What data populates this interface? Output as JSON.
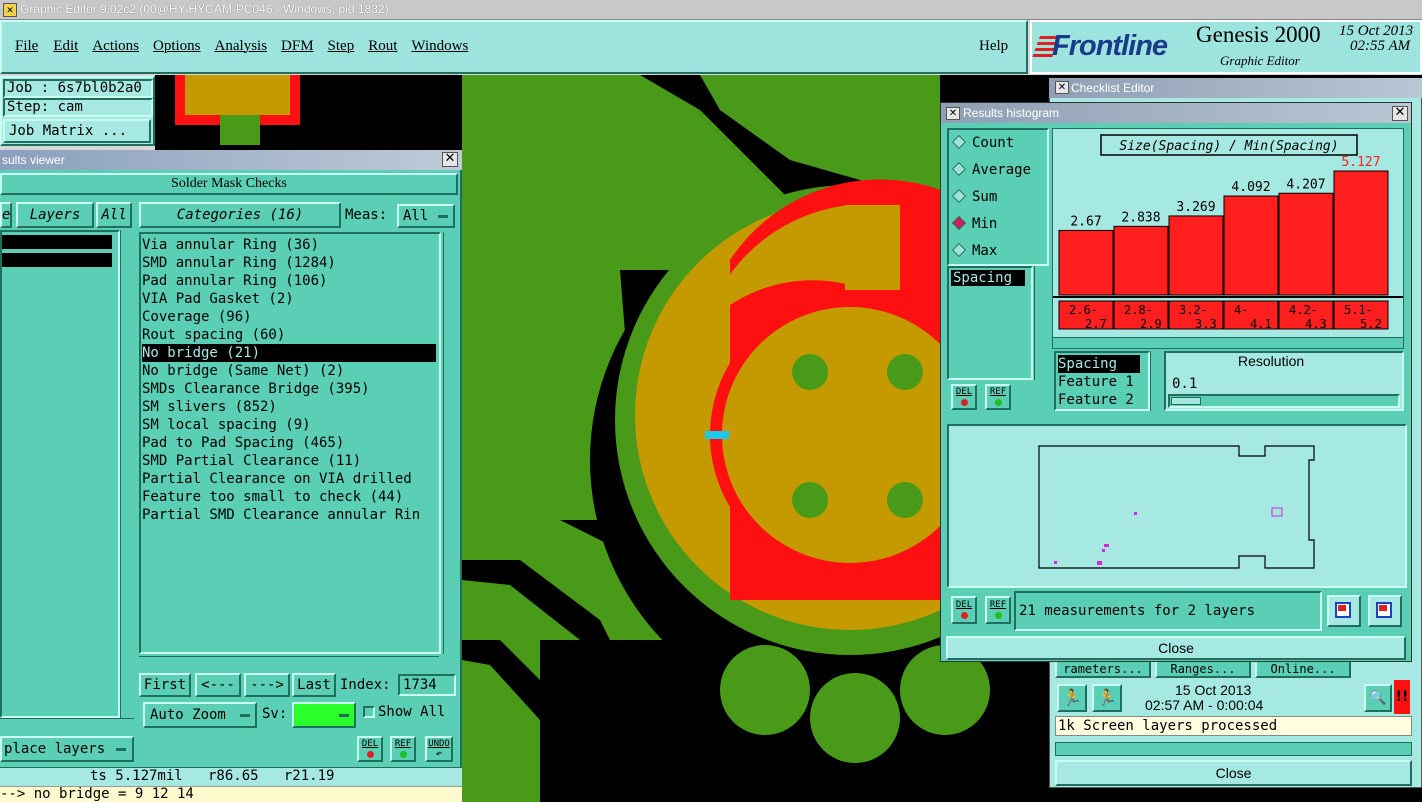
{
  "window": {
    "title": "Graphic Editor 9.02c2 (00@HY-HYCAM-PC046 - Windows, pid:1832)"
  },
  "menu": [
    "File",
    "Edit",
    "Actions",
    "Options",
    "Analysis",
    "DFM",
    "Step",
    "Rout",
    "Windows"
  ],
  "help_label": "Help",
  "brand": {
    "logo": "Frontline",
    "product": "Genesis 2000",
    "subtitle": "Graphic Editor",
    "date": "15 Oct 2013",
    "time": "02:55 AM"
  },
  "job": {
    "job_line": "Job : 6s7bl0b2a0",
    "step_line": "Step: cam",
    "matrix_label": "Job Matrix ..."
  },
  "results_viewer": {
    "title": "sults viewer",
    "header": "Solder Mask Checks",
    "layers_tab": "Layers",
    "all_tab": "All",
    "categories_tab": "Categories (16)",
    "meas_label": "Meas:",
    "meas_value": "All",
    "categories": [
      "Via annular Ring (36)",
      "SMD annular Ring (1284)",
      "Pad annular Ring (106)",
      "VIA Pad Gasket (2)",
      "Coverage (96)",
      "Rout spacing (60)",
      "No bridge (21)",
      "No bridge (Same Net) (2)",
      "SMDs Clearance Bridge (395)",
      "SM slivers (852)",
      "SM local spacing (9)",
      "Pad to Pad Spacing (465)",
      "SMD Partial Clearance (11)",
      "Partial Clearance on VIA drilled",
      "Feature too small to check (44)",
      "Partial SMD Clearance annular Rin"
    ],
    "selected_category": 6,
    "nav": {
      "first": "First",
      "prev": "<---",
      "next": "--->",
      "last": "Last",
      "index_label": "Index:",
      "index_value": "1734"
    },
    "auto_zoom": "Auto Zoom",
    "sv_label": "Sv:",
    "show_all": "Show All",
    "place_layers": "place layers",
    "del": "DEL",
    "ref": "REF",
    "undo": "UNDO"
  },
  "status": {
    "measure": "ts 5.127mil   r86.65   r21.19",
    "command": "--> no bridge = 9 12 14"
  },
  "checklist": {
    "title": "Checklist Editor",
    "buttons": [
      "rameters...",
      "Ranges...",
      "Online..."
    ],
    "date": "15 Oct 2013",
    "time_line": "02:57 AM - 0:00:04",
    "message": "1k Screen layers processed",
    "close": "Close"
  },
  "histogram": {
    "title": "Results histogram",
    "modes": [
      "Count",
      "Average",
      "Sum",
      "Min",
      "Max"
    ],
    "selected_mode": "Min",
    "list_item": "Spacing",
    "del": "DEL",
    "ref": "REF",
    "resolution_label": "Resolution",
    "resolution_value": "0.1",
    "feature_list": [
      "Spacing",
      "Feature 1",
      "Feature 2"
    ],
    "summary": "21 measurements for 2 layers",
    "close": "Close",
    "chart_data": {
      "type": "bar",
      "title": "Size(Spacing) / Min(Spacing)",
      "categories": [
        "2.6-2.7",
        "2.8-2.9",
        "3.2-3.3",
        "4-4.1",
        "4.2-4.3",
        "5.1-5.2"
      ],
      "category_top": [
        "2.6-",
        "2.8-",
        "3.2-",
        "4-",
        "4.2-",
        "5.1-"
      ],
      "category_bottom": [
        "2.7",
        "2.9",
        "3.3",
        "4.1",
        "4.3",
        "5.2"
      ],
      "values": [
        2.67,
        2.838,
        3.269,
        4.092,
        4.207,
        5.127
      ],
      "labels": [
        "2.67",
        "2.838",
        "3.269",
        "4.092",
        "4.207",
        "5.127"
      ],
      "highlight_index": 5,
      "bar_color": "#ff1f1f",
      "highlight_label_color": "#ff1f1f"
    }
  },
  "colors": {
    "canvas_bg": "#000000",
    "copper": "#4a9a1a",
    "mask": "#c49a00",
    "error": "#ff1010",
    "marker": "#1ec8e8"
  }
}
